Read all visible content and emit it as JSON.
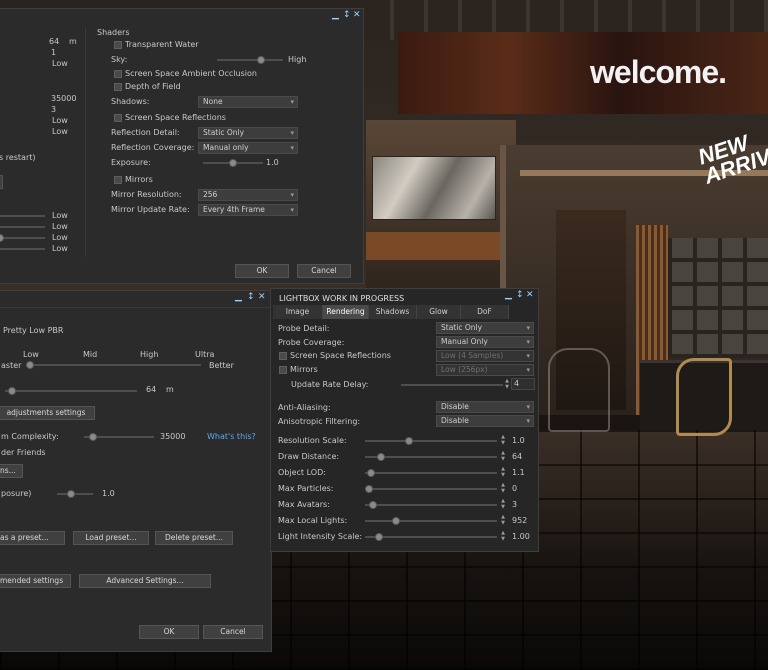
{
  "window_controls": {
    "minimize": "▁",
    "pin": "↕",
    "close": "✕"
  },
  "shaders_panel": {
    "left_values": {
      "v1": "64",
      "v1_unit": "m",
      "v2": "1",
      "v3": "Low",
      "v4": "35000",
      "v5": "3",
      "v6": "Low",
      "v7": "Low",
      "restart_note": "s restart)",
      "low1": "Low",
      "low2": "Low",
      "low3": "Low",
      "low4": "Low"
    },
    "heading": "Shaders",
    "transparent_water": "Transparent Water",
    "sky_label": "Sky:",
    "sky_value": "High",
    "ssao": "Screen Space Ambient Occlusion",
    "dof": "Depth of Field",
    "shadows_label": "Shadows:",
    "shadows_value": "None",
    "ssr": "Screen Space Reflections",
    "reflection_detail_label": "Reflection Detail:",
    "reflection_detail_value": "Static Only",
    "reflection_coverage_label": "Reflection Coverage:",
    "reflection_coverage_value": "Manual only",
    "exposure_label": "Exposure:",
    "exposure_value": "1.0",
    "exposure_level": 0.5,
    "mirrors": "Mirrors",
    "mirror_resolution_label": "Mirror Resolution:",
    "mirror_resolution_value": "256",
    "mirror_update_label": "Mirror Update Rate:",
    "mirror_update_value": "Every 4th Frame",
    "ok": "OK",
    "cancel": "Cancel"
  },
  "prefs_panel": {
    "preset": "Pretty Low PBR",
    "faster": "aster",
    "better": "Better",
    "quality_ticks": [
      "Low",
      "Mid",
      "High",
      "Ultra"
    ],
    "draw_distance_value": "64",
    "draw_distance_unit": "m",
    "adjustments_button": "adjustments settings",
    "complexity_label": "m Complexity:",
    "complexity_value": "35000",
    "whats_this": "What's this?",
    "render_friends": "der Friends",
    "ns_button": "ns...",
    "exposure_label": "posure)",
    "exposure_value": "1.0",
    "save_preset": "as a preset...",
    "load_preset": "Load preset...",
    "delete_preset": "Delete preset...",
    "recommended": "mended settings",
    "advanced": "Advanced Settings...",
    "ok": "OK",
    "cancel": "Cancel"
  },
  "lightbox": {
    "title": "LIGHTBOX WORK IN PROGRESS",
    "tabs": [
      "Image",
      "Rendering",
      "Shadows",
      "Glow",
      "DoF"
    ],
    "active_tab": "Rendering",
    "probe_detail_label": "Probe Detail:",
    "probe_detail_value": "Static Only",
    "probe_coverage_label": "Probe Coverage:",
    "probe_coverage_value": "Manual Only",
    "ssr_label": "Screen Space Reflections",
    "ssr_value": "Low (4 Samples)",
    "mirrors_label": "Mirrors",
    "mirrors_value": "Low (256px)",
    "update_rate_label": "Update Rate Delay:",
    "update_rate_value": "4",
    "aa_label": "Anti-Aliasing:",
    "aa_value": "Disable",
    "af_label": "Anisotropic Filtering:",
    "af_value": "Disable",
    "sliders": [
      {
        "label": "Resolution Scale:",
        "value": "1.0",
        "level": 0.32
      },
      {
        "label": "Draw Distance:",
        "value": "64",
        "level": 0.1
      },
      {
        "label": "Object LOD:",
        "value": "1.1",
        "level": 0.02
      },
      {
        "label": "Max Particles:",
        "value": "0",
        "level": 0.0
      },
      {
        "label": "Max Avatars:",
        "value": "3",
        "level": 0.03
      },
      {
        "label": "Max Local Lights:",
        "value": "952",
        "level": 0.22
      },
      {
        "label": "Light Intensity Scale:",
        "value": "1.00",
        "level": 0.08
      }
    ]
  },
  "scene": {
    "welcome": "welcome.",
    "new_arrivals": "NEW ARRIVA"
  }
}
